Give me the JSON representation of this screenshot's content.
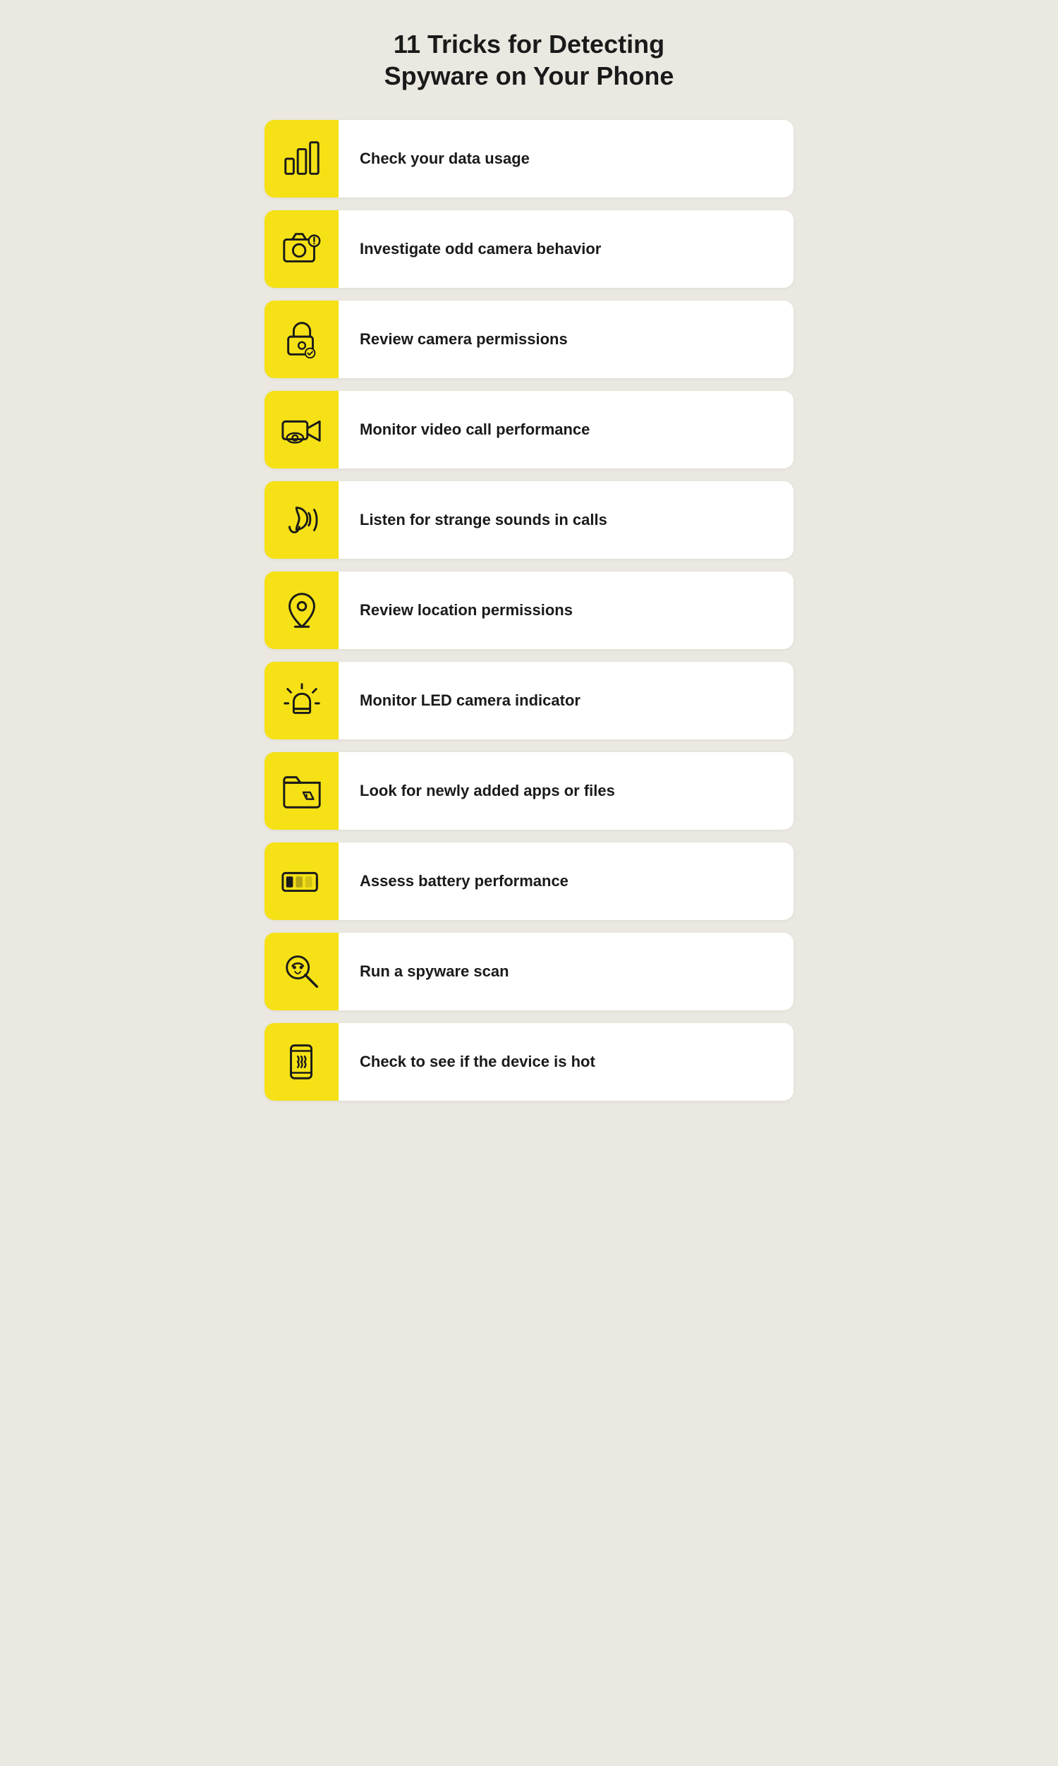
{
  "page": {
    "title_line1": "11 Tricks for Detecting",
    "title_line2": "Spyware on Your Phone"
  },
  "items": [
    {
      "id": 1,
      "label": "Check your data usage",
      "icon": "bar-chart"
    },
    {
      "id": 2,
      "label": "Investigate odd camera behavior",
      "icon": "camera-alert"
    },
    {
      "id": 3,
      "label": "Review camera permissions",
      "icon": "lock-check"
    },
    {
      "id": 4,
      "label": "Monitor video call performance",
      "icon": "video-eye"
    },
    {
      "id": 5,
      "label": "Listen for strange sounds in calls",
      "icon": "ear-waves"
    },
    {
      "id": 6,
      "label": "Review location permissions",
      "icon": "location-pin"
    },
    {
      "id": 7,
      "label": "Monitor LED camera indicator",
      "icon": "alarm-light"
    },
    {
      "id": 8,
      "label": "Look for newly added apps or files",
      "icon": "folder-warning"
    },
    {
      "id": 9,
      "label": "Assess battery performance",
      "icon": "battery-low"
    },
    {
      "id": 10,
      "label": "Run a spyware scan",
      "icon": "spy-search"
    },
    {
      "id": 11,
      "label": "Check to see if the device is hot",
      "icon": "phone-heat"
    }
  ]
}
